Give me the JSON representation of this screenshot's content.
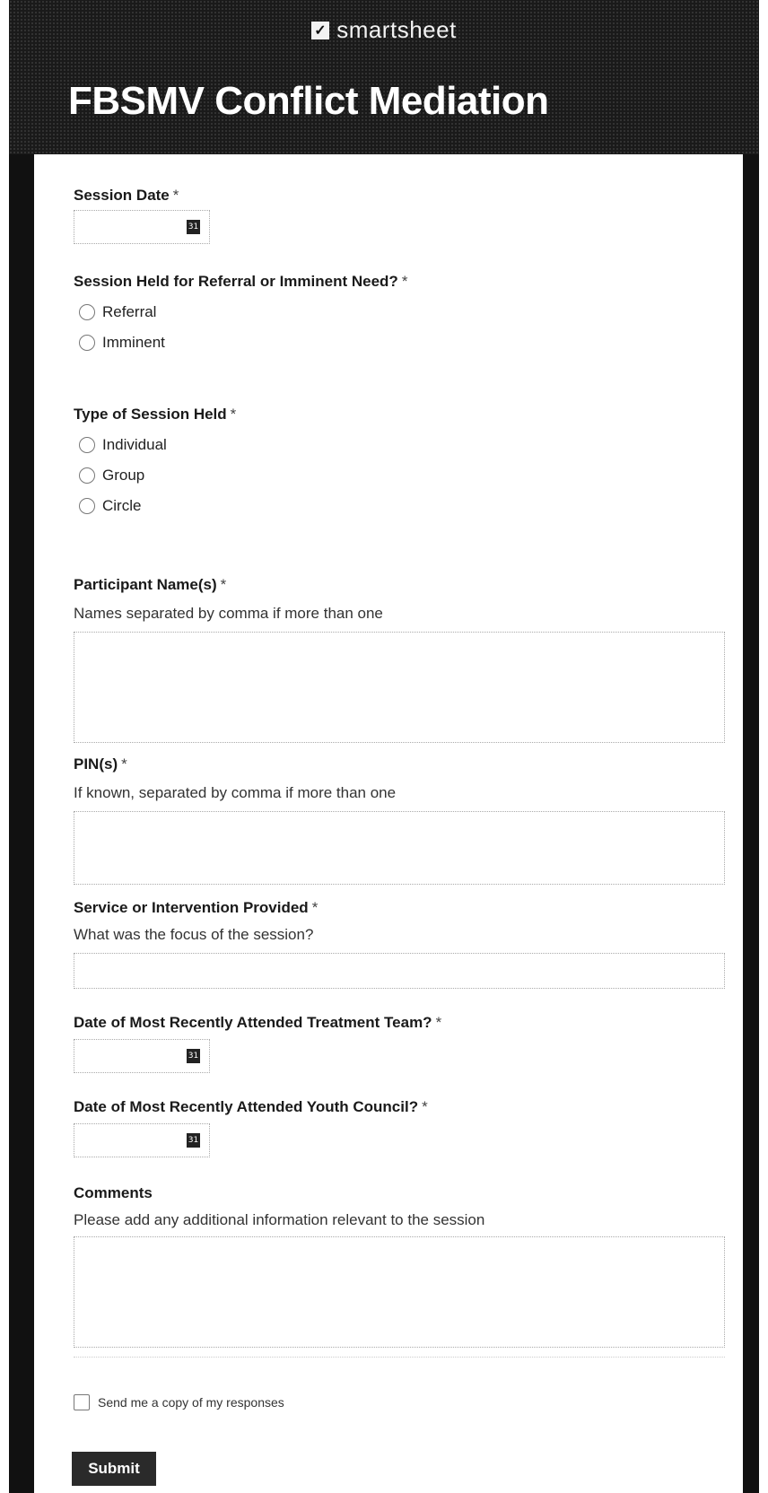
{
  "header": {
    "brand": "smartsheet",
    "brand_icon": "smartsheet-logo-icon",
    "title": "FBSMV Conflict Mediation"
  },
  "form": {
    "required_marker": "*",
    "session_date": {
      "label": "Session Date",
      "value": ""
    },
    "session_held": {
      "label": "Session Held for Referral or Imminent Need?",
      "options": [
        "Referral",
        "Imminent"
      ]
    },
    "session_type": {
      "label": "Type of Session Held",
      "options": [
        "Individual",
        "Group",
        "Circle"
      ]
    },
    "participants": {
      "label": "Participant Name(s)",
      "help": "Names separated by comma if more than one",
      "value": ""
    },
    "pins": {
      "label": "PIN(s)",
      "help": "If known, separated by comma if more than one",
      "value": ""
    },
    "service": {
      "label": "Service or Intervention Provided",
      "help": "What was the focus of the session?",
      "value": ""
    },
    "treatment_team_date": {
      "label": "Date of Most Recently Attended Treatment Team?",
      "value": ""
    },
    "youth_council_date": {
      "label": "Date of Most Recently Attended Youth Council?",
      "value": ""
    },
    "comments": {
      "label": "Comments",
      "help": "Please add any additional information relevant to the session",
      "value": ""
    },
    "copy_checkbox": {
      "label": "Send me a copy of my responses",
      "checked": false
    },
    "submit_label": "Submit"
  },
  "colors": {
    "header_bg": "#1a1a1a",
    "submit_bg": "#2a2a2a",
    "card_bg": "#ffffff"
  }
}
